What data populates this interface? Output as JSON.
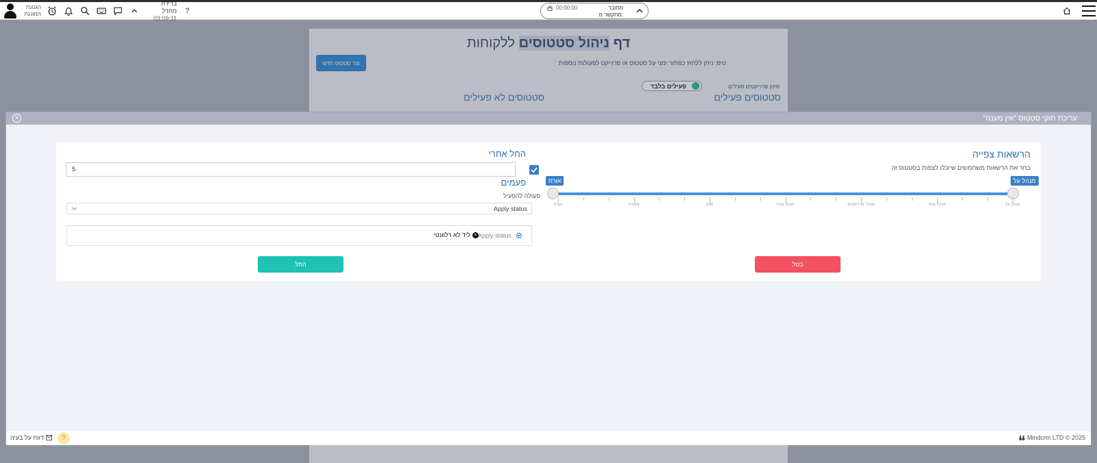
{
  "topbar": {
    "user_name": "הגנונת המונגת",
    "break_label": "ברירת מחדל",
    "break_time": "03:09:11",
    "help": "?",
    "call_status": "מחובר",
    "call_linked": "מתקשר מ:",
    "call_timer": "00:00:00"
  },
  "background": {
    "title_part1": "דף",
    "title_part2": "ניהול סטטוסים",
    "title_part3": "ללקוחות",
    "tip": "טיפ: ניתן ללחוץ כפתור ימני על סטטוס או פרוייקט לפעולות נוספות",
    "create_button": "צור סטטוס חדש",
    "filter_label": "סינון פרוייקטים פעילים",
    "toggle_label": "פעילים בלבד",
    "active_heading": "סטטוסים פעילים",
    "inactive_heading": "סטטוסים לא פעילים"
  },
  "modal": {
    "title": "עריכת חוקי סטטוס \"אין מענה\"",
    "permissions_title": "הרשאות צפייה",
    "permissions_desc": "בחר את הרשאות משתמשים שיוכלו לצפות בסטטוס זה",
    "slider_min_tag": "אורח",
    "slider_max_tag": "מנהל על",
    "slider_labels": [
      "אורח",
      "מפעיל",
      "מתן",
      "מנהל צוות",
      "מנהל פרוייקטים",
      "מנהל אתר",
      "מנהל על"
    ],
    "start_after_title": "החל אחרי",
    "start_after_value": "5",
    "times_label": "פעמים",
    "action_label": "פעולה להפעיל",
    "action_select_value": "Apply status",
    "action_item_label": "Apply status",
    "action_item_tag": "ליד לא רלוונטי",
    "start_button": "החל",
    "cancel_button": "בטל"
  },
  "footer": {
    "report_label": "דווח על בעיה",
    "copyright": "Mindcrm LTD © 2025"
  }
}
